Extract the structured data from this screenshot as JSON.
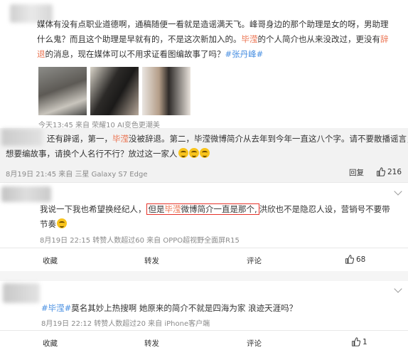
{
  "post1": {
    "line1": "媒体有没有点职业道德啊，通稿随便一看就是造谣满天飞。峰哥身边的那个助理是女的呀，男助理",
    "line2": "什么鬼？而且这个助理是早就有的，不是这次新加入的。",
    "line2_name": "毕滢",
    "line2_rest": "的个人简介也从来没改过，更没有",
    "line2_tail": "辞",
    "line3_a": "退",
    "line3_b": "的消息，现在媒体可以不用求证看图编故事了吗？",
    "line3_tag": "#张丹峰#",
    "meta": "今天13:45 来自 荣耀10 AI变色更潮美"
  },
  "post2": {
    "line1_a": "还有辟谣，第一，",
    "line1_name": "毕滢",
    "line1_b": "没被辞退。第二，毕滢微博简介从去年到今年一直这八个字。请不要散播谣言，",
    "line2": "想要编故事，请换个人名行不行？放过这一家人",
    "meta": "8月19日 21:45 来自 三星 Galaxy S7 Edge",
    "reply": "回复",
    "likes": "216"
  },
  "post3": {
    "line1_a": "我说一下我也希望换经纪人，",
    "line1_box_a": "但是",
    "line1_box_name": "毕滢",
    "line1_box_b": "微博简介一直是那个,",
    "line1_b": "洪欣也不是隐忍人设，营销号不要带",
    "line2": "节奏",
    "meta": "8月19日 22:15 转赞人数超过60 来自 OPPO超视野全面屏R15",
    "actions": {
      "fav": "收藏",
      "repost": "转发",
      "comment": "评论",
      "likes": "68"
    }
  },
  "post4": {
    "tag": "#毕滢#",
    "text": "莫名其妙上热搜啊 她原来的简介不就是四海为家 浪迹天涯吗？",
    "meta": "8月19日 22:12 转赞人数超过20 来自 iPhone客户端",
    "actions": {
      "fav": "收藏",
      "repost": "转发",
      "comment": "评论",
      "likes": "1"
    }
  },
  "colors": {
    "accent_orange": "#eb7350",
    "tag_blue": "#4a90e2",
    "box_red": "#e6332a",
    "panel_gray": "#f2f2f2"
  }
}
